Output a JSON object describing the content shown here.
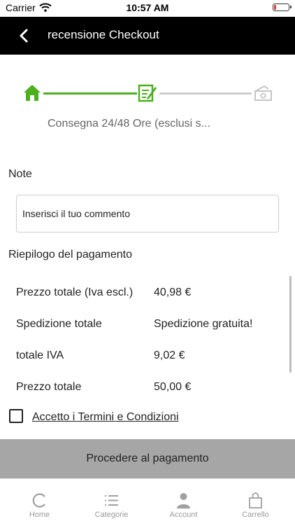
{
  "status_bar": {
    "carrier": "Carrier",
    "time": "10:57 AM",
    "battery_color": "#e53935"
  },
  "header": {
    "title": "recensione Checkout",
    "back_icon": "chevron-left-icon"
  },
  "stepper": {
    "steps": [
      "home-icon",
      "edit-note-icon",
      "cash-icon"
    ],
    "active_color": "#4caf1e",
    "inactive_color": "#cccccc",
    "label": "Consegna 24/48 Ore (esclusi s..."
  },
  "note": {
    "label": "Note",
    "placeholder": "Inserisci il tuo commento",
    "value": ""
  },
  "summary": {
    "title": "Riepilogo del pagamento",
    "rows": [
      {
        "label": "Prezzo totale (Iva escl.)",
        "value": "40,98 €"
      },
      {
        "label": "Spedizione totale",
        "value": "Spedizione gratuita!"
      },
      {
        "label": "totale IVA",
        "value": "9,02 €"
      },
      {
        "label": "Prezzo totale",
        "value": "50,00 €"
      }
    ]
  },
  "terms": {
    "label": "Accetto i Termini e Condizioni",
    "checked": false
  },
  "pay_button": {
    "label": "Procedere al pagamento"
  },
  "tabbar": {
    "tabs": [
      {
        "label": "Home",
        "icon": "home-c-icon"
      },
      {
        "label": "Categorie",
        "icon": "list-icon"
      },
      {
        "label": "Account",
        "icon": "person-icon"
      },
      {
        "label": "Carrello",
        "icon": "shopping-bag-icon"
      }
    ]
  }
}
